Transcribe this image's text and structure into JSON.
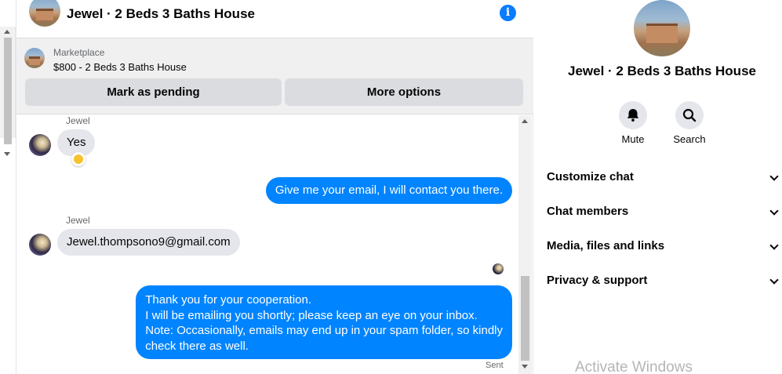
{
  "header": {
    "title": "Jewel · 2 Beds 3 Baths House",
    "info_icon": "info-icon"
  },
  "marketplace": {
    "label": "Marketplace",
    "listing": "$800 - 2 Beds 3 Baths House",
    "mark_pending_label": "Mark as pending",
    "more_options_label": "More options"
  },
  "messages": [
    {
      "direction": "in",
      "sender": "Jewel",
      "text": "Yes",
      "reaction": "like"
    },
    {
      "direction": "out",
      "text": "Give me your email, I will contact you there."
    },
    {
      "direction": "in",
      "sender": "Jewel",
      "text": "Jewel.thompsono9@gmail.com"
    },
    {
      "direction": "out",
      "lines": [
        "Thank you for your cooperation.",
        "I will be emailing you shortly; please keep an eye on your inbox.",
        "Note: Occasionally, emails may end up in your spam folder, so kindly",
        "check there as well."
      ],
      "status": "Sent"
    }
  ],
  "info_panel": {
    "name": "Jewel · 2 Beds 3 Baths House",
    "mute_label": "Mute",
    "search_label": "Search",
    "sections": [
      "Customize chat",
      "Chat members",
      "Media, files and links",
      "Privacy & support"
    ]
  },
  "watermark": "Activate Windows",
  "colors": {
    "outgoing_bubble": "#0084ff",
    "incoming_bubble": "#e4e6eb",
    "accent": "#0a7cff"
  }
}
